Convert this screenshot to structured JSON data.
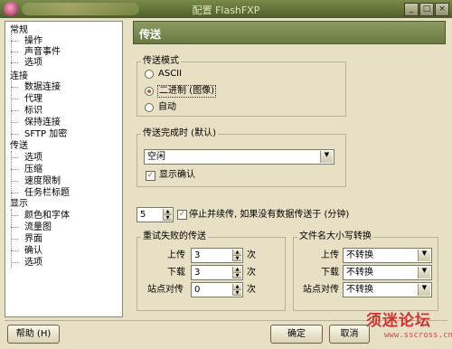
{
  "window": {
    "title": "配置 FlashFXP",
    "buttons": {
      "minimize": "_",
      "maximize": "□",
      "close": "×"
    }
  },
  "tree": {
    "items": [
      {
        "label": "常规",
        "level": 0
      },
      {
        "label": "操作",
        "level": 1
      },
      {
        "label": "声音事件",
        "level": 1
      },
      {
        "label": "选项",
        "level": 1
      },
      {
        "label": "连接",
        "level": 0
      },
      {
        "label": "数据连接",
        "level": 1
      },
      {
        "label": "代理",
        "level": 1
      },
      {
        "label": "标识",
        "level": 1
      },
      {
        "label": "保持连接",
        "level": 1
      },
      {
        "label": "SFTP 加密",
        "level": 1
      },
      {
        "label": "传送",
        "level": 0
      },
      {
        "label": "选项",
        "level": 1
      },
      {
        "label": "压缩",
        "level": 1
      },
      {
        "label": "速度限制",
        "level": 1
      },
      {
        "label": "任务栏标题",
        "level": 1
      },
      {
        "label": "显示",
        "level": 0
      },
      {
        "label": "颜色和字体",
        "level": 1
      },
      {
        "label": "流量图",
        "level": 1
      },
      {
        "label": "界面",
        "level": 1
      },
      {
        "label": "确认",
        "level": 1
      },
      {
        "label": "选项",
        "level": 1
      }
    ]
  },
  "panel": {
    "title": "传送"
  },
  "transfer_mode": {
    "group_label": "传送模式",
    "options": [
      {
        "label": "ASCII",
        "selected": false
      },
      {
        "label": "二进制 (图像)",
        "selected": true
      },
      {
        "label": "自动",
        "selected": false
      }
    ]
  },
  "transfer_complete": {
    "group_label": "传送完成时 (默认)",
    "select_value": "空闲",
    "show_confirm_label": "显示确认",
    "show_confirm_checked": true
  },
  "stall": {
    "value": "5",
    "checked": true,
    "label": "停止并续传, 如果没有数据传送于 (分钟)"
  },
  "retry": {
    "group_label": "重试失败的传送",
    "rows": [
      {
        "label": "上传",
        "value": "3",
        "unit": "次"
      },
      {
        "label": "下载",
        "value": "3",
        "unit": "次"
      },
      {
        "label": "站点对传",
        "value": "0",
        "unit": "次"
      }
    ]
  },
  "case_convert": {
    "group_label": "文件名大小写转换",
    "rows": [
      {
        "label": "上传",
        "value": "不转换"
      },
      {
        "label": "下载",
        "value": "不转换"
      },
      {
        "label": "站点对传",
        "value": "不转换"
      }
    ]
  },
  "footer": {
    "help_label": "帮助 (H)",
    "ok_label": "确定",
    "cancel_label": "取消"
  },
  "watermark": {
    "text": "须迷论坛",
    "url": "www.sscross.cn"
  },
  "colors": {
    "accent": "#b06020",
    "header_bg": "#7a8a4a",
    "window_bg": "#e8e0c4"
  }
}
